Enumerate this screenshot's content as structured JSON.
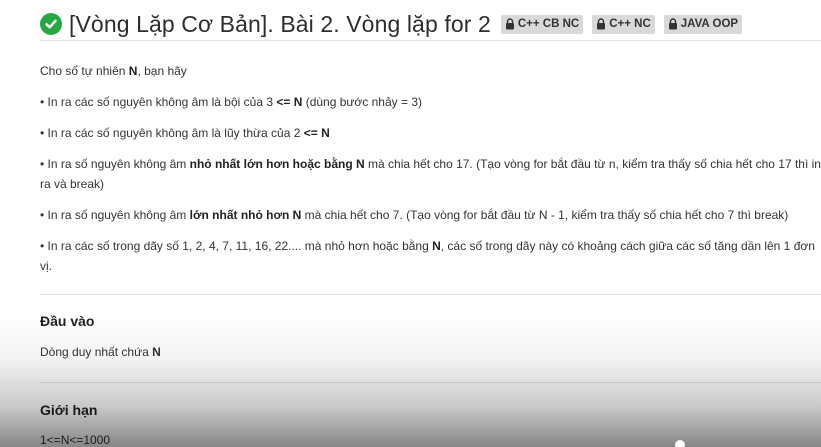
{
  "header": {
    "title": "[Vòng Lặp Cơ Bản]. Bài 2. Vòng lặp for 2",
    "tags": [
      {
        "label": "C++ CB NC",
        "icon": "lock-icon"
      },
      {
        "label": "C++ NC",
        "icon": "lock-icon"
      },
      {
        "label": "JAVA OOP",
        "icon": "lock-icon"
      }
    ],
    "status_icon": "check-circle-icon",
    "status_color": "#28a745"
  },
  "problem": {
    "intro": [
      {
        "text": "Cho số tự nhiên ",
        "bold": false
      },
      {
        "text": "N",
        "bold": true
      },
      {
        "text": ", bạn hãy",
        "bold": false
      }
    ],
    "bullets": [
      [
        {
          "text": "• In ra các số nguyên không âm là bội của 3 ",
          "bold": false
        },
        {
          "text": "<= N",
          "bold": true
        },
        {
          "text": " (dùng bước nhảy = 3)",
          "bold": false
        }
      ],
      [
        {
          "text": "• In ra các số nguyên không âm là lũy thừa của 2 ",
          "bold": false
        },
        {
          "text": "<= N",
          "bold": true
        }
      ],
      [
        {
          "text": "• In ra số nguyên không âm ",
          "bold": false
        },
        {
          "text": "nhỏ nhất lớn hơn hoặc bằng N",
          "bold": true
        },
        {
          "text": " mà chia hết cho 17. (Tạo vòng for bắt đầu từ n, kiểm tra thấy số chia hết cho 17 thì in ra và break)",
          "bold": false
        }
      ],
      [
        {
          "text": "• In ra số nguyên không âm ",
          "bold": false
        },
        {
          "text": "lớn nhất nhỏ hơn N",
          "bold": true
        },
        {
          "text": " mà chia hết cho 7. (Tạo vòng for bắt đầu từ N - 1, kiểm tra thấy số chia hết cho 7 thì break)",
          "bold": false
        }
      ],
      [
        {
          "text": "• In ra các số trong dãy số 1, 2, 4, 7, 11, 16, 22.... mà nhỏ hơn hoặc bằng ",
          "bold": false
        },
        {
          "text": "N",
          "bold": true
        },
        {
          "text": ", các số trong dãy này có khoảng cách giữa các số tăng dần lên 1 đơn vị.",
          "bold": false
        }
      ]
    ]
  },
  "input_section": {
    "heading": "Đầu vào",
    "text_prefix": "Dòng duy nhất chứa ",
    "text_bold": "N"
  },
  "limit_section": {
    "heading": "Giới hạn",
    "text": "1<=N<=1000"
  }
}
